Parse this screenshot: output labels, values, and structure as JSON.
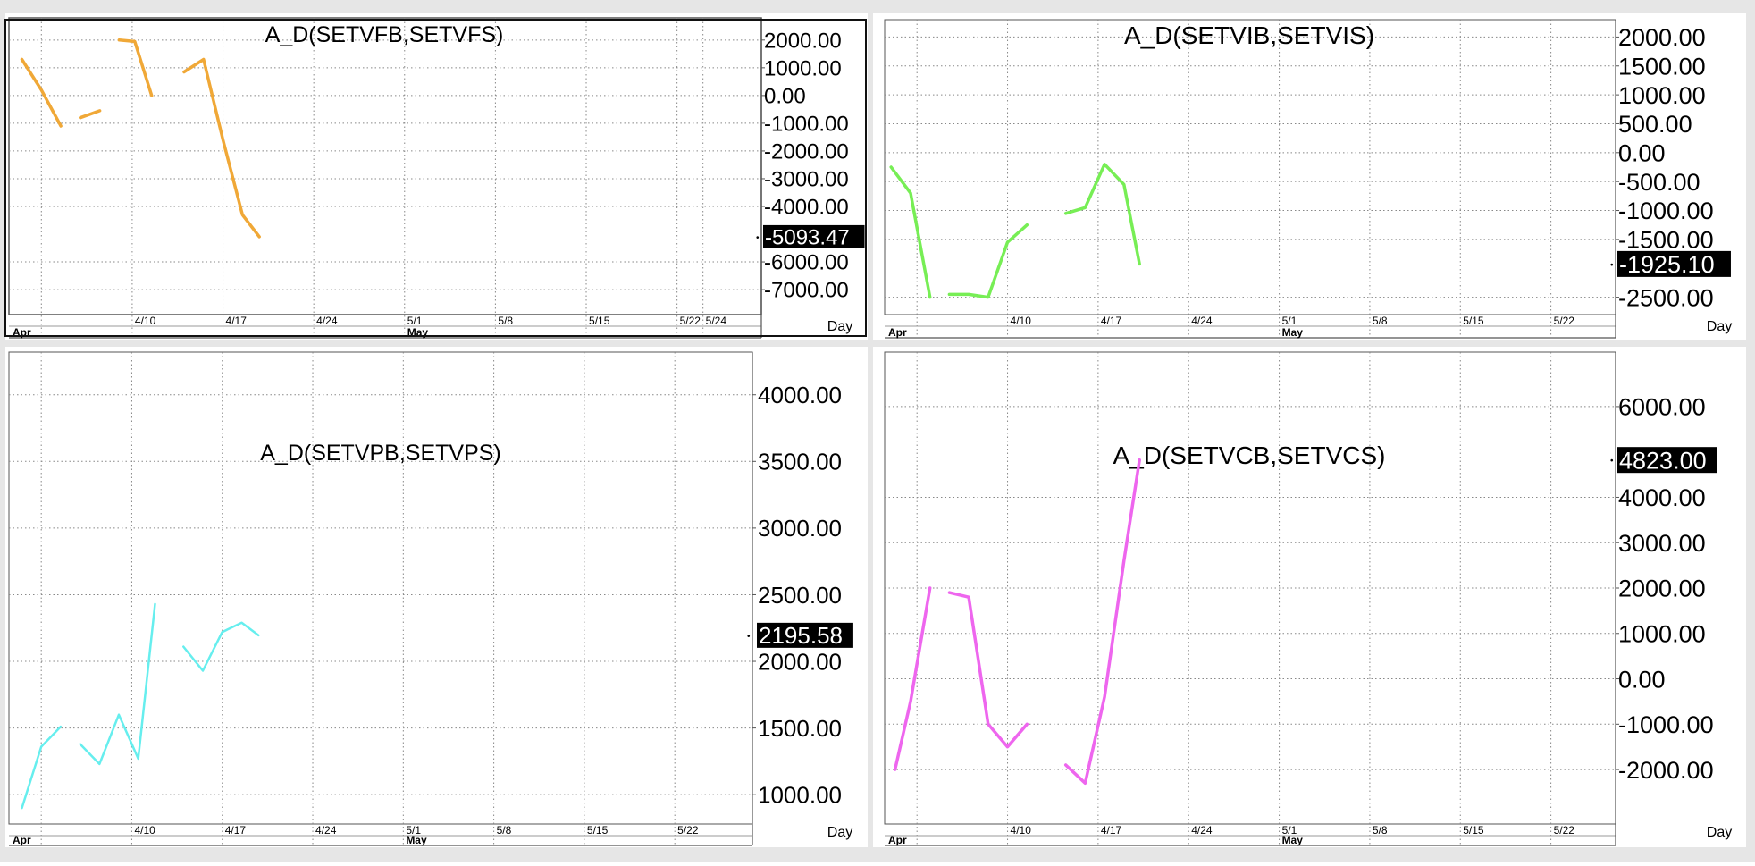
{
  "window": {
    "background": "#e6e6e6"
  },
  "chart_data": [
    {
      "type": "line",
      "title": "A_D(SETVFB,SETVFS)",
      "color": "#f0a837",
      "xlabel": "Day",
      "x_ticks": [
        "4/10",
        "4/17",
        "4/24",
        "5/1",
        "5/8",
        "5/15",
        "5/22",
        "5/24"
      ],
      "x_tick_days": [
        9,
        16,
        23,
        30,
        37,
        44,
        51,
        53
      ],
      "month_labels": [
        {
          "text": "Apr",
          "day": 0
        },
        {
          "text": "May",
          "day": 30
        }
      ],
      "y_ticks": [
        "2000.00",
        "1000.00",
        "0.00",
        "-1000.00",
        "-2000.00",
        "-3000.00",
        "-4000.00",
        "-6000.00",
        "-7000.00"
      ],
      "y_tick_values": [
        2000,
        1000,
        0,
        -1000,
        -2000,
        -3000,
        -4000,
        -6000,
        -7000
      ],
      "ylim": [
        -7900,
        2800
      ],
      "xlim": [
        -0.5,
        57.5
      ],
      "last_value": "-5093.47",
      "last_value_num": -5093.47,
      "grid": true,
      "segments": [
        {
          "x": [
            0.5,
            2,
            3.5
          ],
          "y": [
            1300,
            200,
            -1100
          ]
        },
        {
          "x": [
            5,
            6.5
          ],
          "y": [
            -800,
            -550
          ]
        },
        {
          "x": [
            8,
            9.2,
            10.5
          ],
          "y": [
            2000,
            1950,
            0
          ]
        },
        {
          "x": [
            13,
            14.5,
            16,
            17.5,
            18.8
          ],
          "y": [
            850,
            1300,
            -1600,
            -4300,
            -5093.47
          ]
        }
      ]
    },
    {
      "type": "line",
      "title": "A_D(SETVIB,SETVIS)",
      "color": "#77ee55",
      "xlabel": "Day",
      "x_ticks": [
        "4/10",
        "4/17",
        "4/24",
        "5/1",
        "5/8",
        "5/15",
        "5/22"
      ],
      "x_tick_days": [
        9,
        16,
        23,
        30,
        37,
        44,
        51
      ],
      "month_labels": [
        {
          "text": "Apr",
          "day": 0
        },
        {
          "text": "May",
          "day": 30
        }
      ],
      "y_ticks": [
        "2000.00",
        "1500.00",
        "1000.00",
        "500.00",
        "0.00",
        "-500.00",
        "-1000.00",
        "-1500.00",
        "-2500.00"
      ],
      "y_tick_values": [
        2000,
        1500,
        1000,
        500,
        0,
        -500,
        -1000,
        -1500,
        -2500
      ],
      "ylim": [
        -2800,
        2300
      ],
      "xlim": [
        -0.5,
        56
      ],
      "last_value": "-1925.10",
      "last_value_num": -1925.1,
      "grid": true,
      "segments": [
        {
          "x": [
            0,
            1.5,
            3
          ],
          "y": [
            -250,
            -700,
            -2500
          ]
        },
        {
          "x": [
            4.5,
            6,
            7.5,
            9,
            10.5
          ],
          "y": [
            -2450,
            -2450,
            -2500,
            -1550,
            -1250
          ]
        },
        {
          "x": [
            13.5,
            15,
            16.5,
            18,
            19.2
          ],
          "y": [
            -1050,
            -950,
            -200,
            -550,
            -1925.1
          ]
        }
      ]
    },
    {
      "type": "line",
      "title": "A_D(SETVPB,SETVPS)",
      "color": "#66eeee",
      "xlabel": "Day",
      "x_ticks": [
        "4/10",
        "4/17",
        "4/24",
        "5/1",
        "5/8",
        "5/15",
        "5/22"
      ],
      "x_tick_days": [
        9,
        16,
        23,
        30,
        37,
        44,
        51
      ],
      "month_labels": [
        {
          "text": "Apr",
          "day": 0
        },
        {
          "text": "May",
          "day": 30
        }
      ],
      "y_ticks": [
        "4000.00",
        "3500.00",
        "3000.00",
        "2500.00",
        "2000.00",
        "1500.00",
        "1000.00"
      ],
      "y_tick_values": [
        4000,
        3500,
        3000,
        2500,
        2000,
        1500,
        1000
      ],
      "ylim": [
        780,
        4320
      ],
      "xlim": [
        -0.5,
        57
      ],
      "last_value": "2195.58",
      "last_value_num": 2195.58,
      "grid": true,
      "segments": [
        {
          "x": [
            0.5,
            2,
            3.5
          ],
          "y": [
            900,
            1360,
            1510
          ]
        },
        {
          "x": [
            5,
            6.5,
            8,
            9.5,
            10.8
          ],
          "y": [
            1380,
            1230,
            1600,
            1270,
            2430
          ]
        },
        {
          "x": [
            13,
            14.5,
            16,
            17.5,
            18.8
          ],
          "y": [
            2110,
            1930,
            2220,
            2290,
            2195.58
          ]
        }
      ]
    },
    {
      "type": "line",
      "title": "A_D(SETVCB,SETVCS)",
      "color": "#ee66ee",
      "xlabel": "Day",
      "x_ticks": [
        "4/10",
        "4/17",
        "4/24",
        "5/1",
        "5/8",
        "5/15",
        "5/22"
      ],
      "x_tick_days": [
        9,
        16,
        23,
        30,
        37,
        44,
        51
      ],
      "month_labels": [
        {
          "text": "Apr",
          "day": 0
        },
        {
          "text": "May",
          "day": 30
        }
      ],
      "y_ticks": [
        "6000.00",
        "4000.00",
        "3000.00",
        "2000.00",
        "1000.00",
        "0.00",
        "-1000.00",
        "-2000.00"
      ],
      "y_tick_values": [
        6000,
        4000,
        3000,
        2000,
        1000,
        0,
        -1000,
        -2000
      ],
      "ylim": [
        -3200,
        7200
      ],
      "xlim": [
        -0.5,
        56
      ],
      "last_value": "4823.00",
      "last_value_num": 4823,
      "grid": true,
      "segments": [
        {
          "x": [
            0.3,
            1.5,
            3
          ],
          "y": [
            -2000,
            -500,
            2000
          ]
        },
        {
          "x": [
            4.5,
            6,
            7.5,
            9,
            10.5
          ],
          "y": [
            1900,
            1800,
            -1000,
            -1500,
            -1000
          ]
        },
        {
          "x": [
            13.5,
            15,
            16.5,
            18,
            19.2
          ],
          "y": [
            -1900,
            -2300,
            -400,
            2600,
            4823
          ]
        }
      ]
    }
  ]
}
